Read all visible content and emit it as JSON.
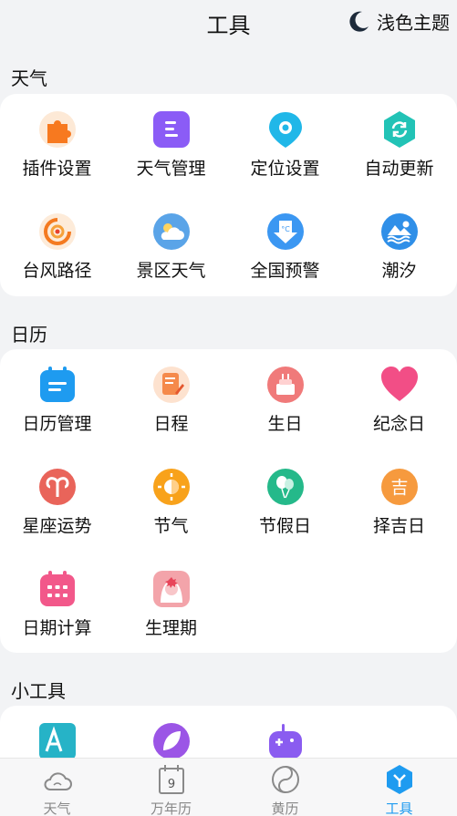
{
  "header": {
    "title": "工具",
    "theme_label": "浅色主题"
  },
  "sections": {
    "weather": {
      "title": "天气",
      "items": [
        "插件设置",
        "天气管理",
        "定位设置",
        "自动更新",
        "台风路径",
        "景区天气",
        "全国预警",
        "潮汐"
      ]
    },
    "calendar": {
      "title": "日历",
      "items": [
        "日历管理",
        "日程",
        "生日",
        "纪念日",
        "星座运势",
        "节气",
        "节假日",
        "择吉日",
        "日期计算",
        "生理期"
      ]
    },
    "tools": {
      "title": "小工具"
    }
  },
  "tabbar": {
    "tabs": [
      "天气",
      "万年历",
      "黄历",
      "工具"
    ],
    "calendar_day": "9"
  },
  "colors": {
    "accent": "#1e9bf0",
    "background": "#f2f3f5"
  }
}
